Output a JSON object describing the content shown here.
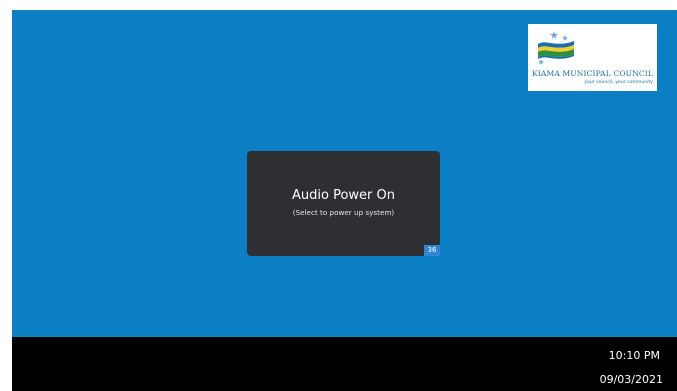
{
  "logo": {
    "title": "KIAMA MUNICIPAL COUNCIL",
    "tagline": "your council, your community",
    "colors": {
      "blue": "#1b6fa8",
      "green": "#2f8f3a",
      "yellow": "#f1cf2f"
    }
  },
  "main": {
    "background_color": "#0b7ec4",
    "power_tile": {
      "title": "Audio Power On",
      "subtitle": "(Select to  power up system)",
      "badge": "36"
    }
  },
  "status_bar": {
    "time": "10:10 PM",
    "date": "09/03/2021"
  }
}
